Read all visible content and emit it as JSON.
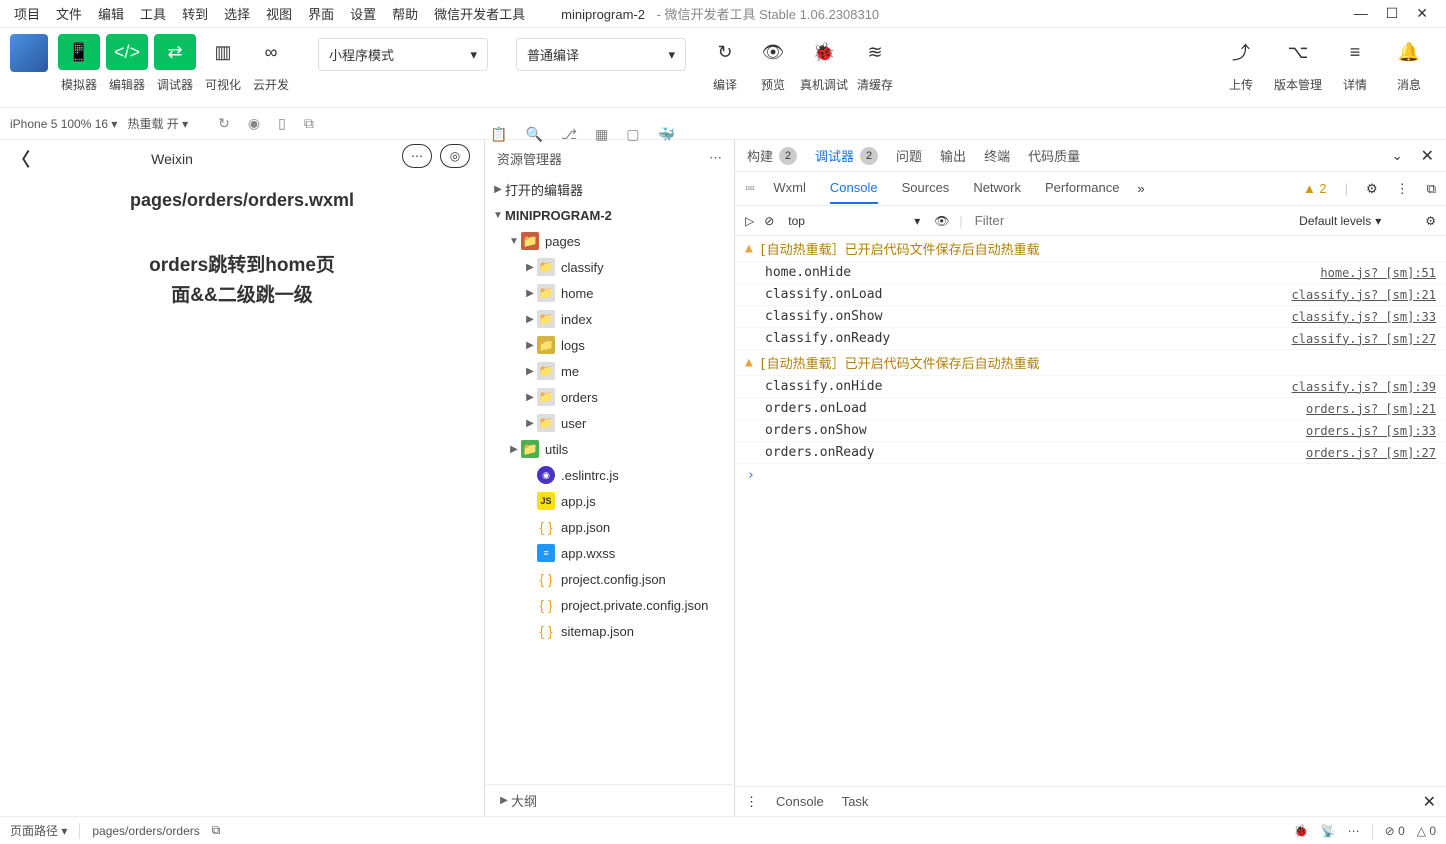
{
  "menubar": {
    "items": [
      "项目",
      "文件",
      "编辑",
      "工具",
      "转到",
      "选择",
      "视图",
      "界面",
      "设置",
      "帮助",
      "微信开发者工具"
    ],
    "project": "miniprogram-2",
    "subtitle": "- 微信开发者工具 Stable 1.06.2308310"
  },
  "toolbar": {
    "cols": [
      {
        "label": "模拟器",
        "icon": "📱",
        "green": true
      },
      {
        "label": "编辑器",
        "icon": "</>",
        "green": true
      },
      {
        "label": "调试器",
        "icon": "⇄",
        "green": true
      },
      {
        "label": "可视化",
        "icon": "▥"
      },
      {
        "label": "云开发",
        "icon": "∞"
      }
    ],
    "mode": "小程序模式",
    "compile": "普通编译",
    "actions": [
      {
        "label": "编译",
        "icon": "↻"
      },
      {
        "label": "预览",
        "icon": "👁"
      },
      {
        "label": "真机调试",
        "icon": "🐞"
      },
      {
        "label": "清缓存",
        "icon": "≋"
      }
    ],
    "right": [
      {
        "label": "上传",
        "icon": "⤴"
      },
      {
        "label": "版本管理",
        "icon": "⌥"
      },
      {
        "label": "详情",
        "icon": "≡"
      },
      {
        "label": "消息",
        "icon": "🔔"
      }
    ]
  },
  "secondbar": {
    "device": "iPhone 5 100% 16 ▾",
    "hotreload": "热重载 开 ▾"
  },
  "simulator": {
    "title": "Weixin",
    "path": "pages/orders/orders.wxml",
    "text": "orders跳转到home页面&&二级跳一级"
  },
  "explorer": {
    "title": "资源管理器",
    "opened": "打开的编辑器",
    "project": "MINIPROGRAM-2",
    "pages": "pages",
    "page_children": [
      "classify",
      "home",
      "index",
      "logs",
      "me",
      "orders",
      "user"
    ],
    "utils": "utils",
    "files": [
      {
        "name": ".eslintrc.js",
        "cls": "eslintfile",
        "g": "◉"
      },
      {
        "name": "app.js",
        "cls": "jsfile",
        "g": "JS"
      },
      {
        "name": "app.json",
        "cls": "jsonfile",
        "g": "{ }"
      },
      {
        "name": "app.wxss",
        "cls": "wxssfile",
        "g": "≡"
      },
      {
        "name": "project.config.json",
        "cls": "jsonfile",
        "g": "{ }"
      },
      {
        "name": "project.private.config.json",
        "cls": "jsonfile",
        "g": "{ }"
      },
      {
        "name": "sitemap.json",
        "cls": "jsonfile",
        "g": "{ }"
      }
    ],
    "outline": "大纲"
  },
  "devtools": {
    "tabs": [
      {
        "label": "构建",
        "badge": "2"
      },
      {
        "label": "调试器",
        "badge": "2",
        "active": true
      },
      {
        "label": "问题"
      },
      {
        "label": "输出"
      },
      {
        "label": "终端"
      },
      {
        "label": "代码质量"
      }
    ],
    "subtabs": [
      "Wxml",
      "Console",
      "Sources",
      "Network",
      "Performance"
    ],
    "subtab_active": "Console",
    "warn_count": "2",
    "context": "top",
    "filter_placeholder": "Filter",
    "levels": "Default levels",
    "console": [
      {
        "type": "warn",
        "msg": "[自动热重载］已开启代码文件保存后自动热重载"
      },
      {
        "type": "log",
        "msg": "home.onHide",
        "link": "home.js? [sm]:51"
      },
      {
        "type": "log",
        "msg": "classify.onLoad",
        "link": "classify.js? [sm]:21"
      },
      {
        "type": "log",
        "msg": "classify.onShow",
        "link": "classify.js? [sm]:33"
      },
      {
        "type": "log",
        "msg": "classify.onReady",
        "link": "classify.js? [sm]:27"
      },
      {
        "type": "warn",
        "msg": "[自动热重载］已开启代码文件保存后自动热重载"
      },
      {
        "type": "log",
        "msg": "classify.onHide",
        "link": "classify.js? [sm]:39"
      },
      {
        "type": "log",
        "msg": "orders.onLoad",
        "link": "orders.js? [sm]:21"
      },
      {
        "type": "log",
        "msg": "orders.onShow",
        "link": "orders.js? [sm]:33"
      },
      {
        "type": "log",
        "msg": "orders.onReady",
        "link": "orders.js? [sm]:27"
      }
    ],
    "drawer_tabs": [
      "Console",
      "Task"
    ]
  },
  "statusbar": {
    "pagepath_label": "页面路径 ▾",
    "pagepath": "pages/orders/orders",
    "err": "0",
    "warn": "0"
  }
}
